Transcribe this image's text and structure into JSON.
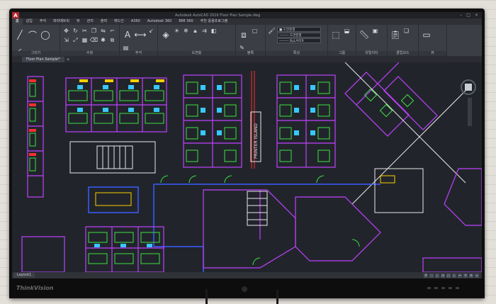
{
  "brand": "ThinkVision",
  "window": {
    "app_icon": "A",
    "title": "Autodesk AutoCAD 2016  Floor Plan Sample.dwg",
    "controls": [
      "–",
      "□",
      "×"
    ]
  },
  "ribbon_tabs": [
    "홈",
    "삽입",
    "주석",
    "파라메트릭",
    "뷰",
    "관리",
    "출력",
    "애드인",
    "A360",
    "Autodesk 360",
    "BIM 360",
    "추천 응용프로그램"
  ],
  "ribbon_panels": [
    {
      "label": "그리기"
    },
    {
      "label": "수정"
    },
    {
      "label": "주석"
    },
    {
      "label": "도면층"
    },
    {
      "label": "블록"
    },
    {
      "label": "특성"
    },
    {
      "label": "그룹"
    },
    {
      "label": "유틸리티"
    },
    {
      "label": "클립보드"
    },
    {
      "label": "뷰"
    }
  ],
  "properties_combos": [
    "■ 도면층별",
    "───── 도면층별",
    "───── ByLAYER"
  ],
  "file_tab": "Floor Plan Sample*",
  "drawing_labels": {
    "printer_island": "PRINTER ISLAND"
  },
  "layout_tab": "Layout1",
  "colors": {
    "walls": "#c040ff",
    "furniture": "#38c8ff",
    "green": "#40e040",
    "yellow": "#ffd000",
    "blue": "#3a5cff",
    "red": "#ff3030",
    "white": "#e8e8e8"
  }
}
